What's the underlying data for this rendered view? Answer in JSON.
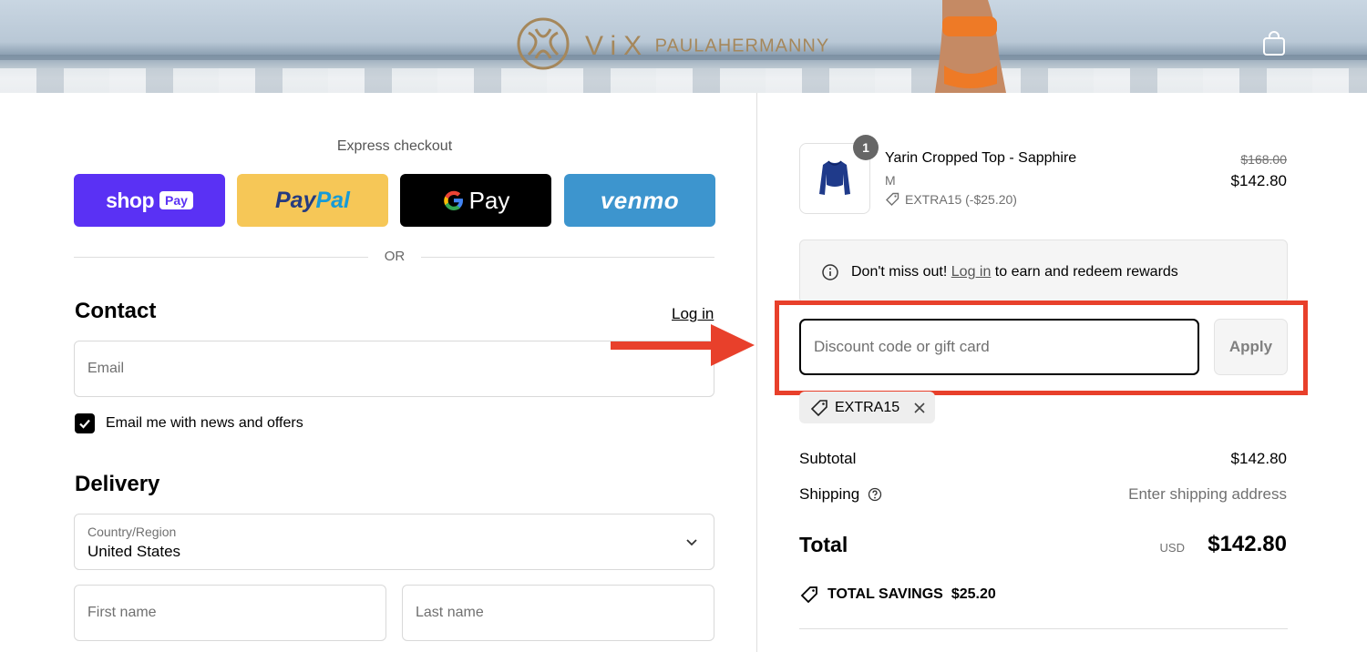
{
  "header": {
    "brand_vix": "ViX",
    "brand_name": "PAULAHERMANNY"
  },
  "express": {
    "title": "Express checkout",
    "buttons": {
      "shop": "shop",
      "shop_pay": "Pay",
      "paypal_a": "Pay",
      "paypal_b": "Pal",
      "gpay_g": "G",
      "gpay_pay": "Pay",
      "venmo": "venmo"
    },
    "or_label": "OR"
  },
  "contact": {
    "heading": "Contact",
    "login_link": "Log in",
    "email_placeholder": "Email",
    "newsletter_label": "Email me with news and offers",
    "newsletter_checked": true
  },
  "delivery": {
    "heading": "Delivery",
    "country_label": "Country/Region",
    "country_value": "United States",
    "first_name_placeholder": "First name",
    "last_name_placeholder": "Last name"
  },
  "order": {
    "item": {
      "quantity": "1",
      "name": "Yarin Cropped Top - Sapphire",
      "variant": "M",
      "discount_line": "EXTRA15 (-$25.20)",
      "original_price": "$168.00",
      "price": "$142.80"
    },
    "rewards": {
      "prefix": "Don't miss out! ",
      "link": "Log in",
      "suffix": " to earn and redeem rewards"
    },
    "discount": {
      "placeholder": "Discount code or gift card",
      "apply_label": "Apply",
      "applied_code": "EXTRA15"
    },
    "summary": {
      "subtotal_label": "Subtotal",
      "subtotal_value": "$142.80",
      "shipping_label": "Shipping",
      "shipping_value": "Enter shipping address",
      "total_label": "Total",
      "currency": "USD",
      "total_value": "$142.80",
      "savings_label": "TOTAL SAVINGS",
      "savings_value": "$25.20"
    }
  },
  "colors": {
    "shop_pay": "#5a31f4",
    "paypal": "#f6c757",
    "venmo": "#3d95ce",
    "annotation_red": "#e8402b",
    "brand_gold": "#a5875b"
  }
}
